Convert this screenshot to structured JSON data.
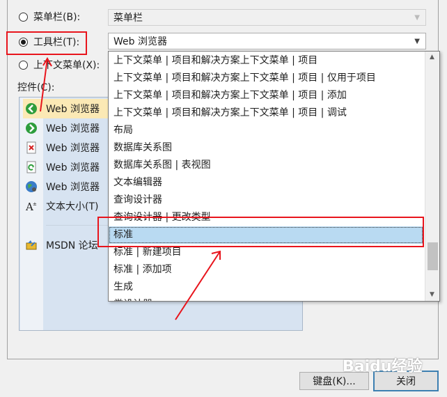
{
  "options": {
    "menubar": {
      "label": "菜单栏(B):",
      "combo_value": "菜单栏"
    },
    "toolbar": {
      "label": "工具栏(T):",
      "combo_value": "Web 浏览器"
    },
    "context_menu": {
      "label": "上下文菜单(X):"
    }
  },
  "controls": {
    "label": "控件(C):",
    "items": [
      {
        "label": "Web 浏览器",
        "icon": "back-arrow-icon",
        "selected": true
      },
      {
        "label": "Web 浏览器",
        "icon": "forward-arrow-icon"
      },
      {
        "label": "Web 浏览器",
        "icon": "stop-icon"
      },
      {
        "label": "Web 浏览器",
        "icon": "refresh-icon"
      },
      {
        "label": "Web 浏览器",
        "icon": "globe-icon"
      },
      {
        "label": "文本大小(T)",
        "icon": "font-size-icon"
      },
      {
        "label": "MSDN 论坛",
        "icon": "msdn-forum-icon"
      }
    ]
  },
  "dropdown": {
    "items": [
      "上下文菜单 | 项目和解决方案上下文菜单 | 项目",
      "上下文菜单 | 项目和解决方案上下文菜单 | 项目 | 仅用于项目",
      "上下文菜单 | 项目和解决方案上下文菜单 | 项目 | 添加",
      "上下文菜单 | 项目和解决方案上下文菜单 | 项目 | 调试",
      "布局",
      "数据库关系图",
      "数据库关系图 | 表视图",
      "文本编辑器",
      "查询设计器",
      "查询设计器 | 更改类型",
      "标准",
      "标准 | 新建项目",
      "标准 | 添加项",
      "生成",
      "类设计器"
    ],
    "highlighted": "标准"
  },
  "buttons": {
    "keyboard": "键盘(K)...",
    "close": "关闭"
  },
  "watermark": "Baidu经验",
  "colors": {
    "annotation": "#e8141c",
    "highlight": "#b9daf2",
    "selected": "#fbe9b5"
  }
}
